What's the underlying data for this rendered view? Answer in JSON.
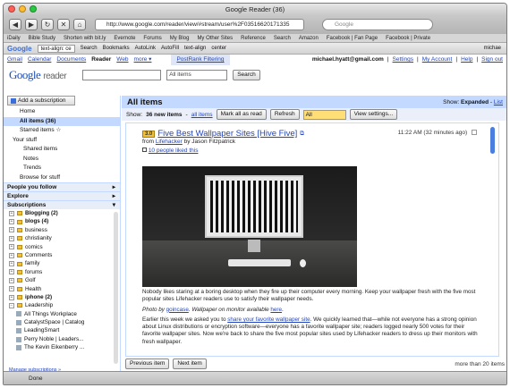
{
  "browser": {
    "title": "Google Reader (36)",
    "url": "http://www.google.com/reader/view/#stream/user%2F03516620171335",
    "search_placeholder": "Google",
    "bookmarks": [
      "iDaily",
      "Bible Study",
      "Shorten with bit.ly",
      "Evernote",
      "Forums",
      "My Blog",
      "My Other Sites",
      "Reference",
      "Search",
      "Amazon",
      "Facebook | Fan Page",
      "Facebook | Private"
    ],
    "gtoolbar": [
      "Google",
      "text-align: ce",
      "Search",
      "Bookmarks",
      "AutoLink",
      "AutoFill",
      "text-align",
      "center",
      "michae"
    ],
    "status": "Done"
  },
  "topnav": {
    "links": [
      "Gmail",
      "Calendar",
      "Documents",
      "Reader",
      "Web",
      "more ▾"
    ],
    "postrank": "PostRank Filtering",
    "email": "michael.hyatt@gmail.com",
    "settings": "Settings",
    "account": "My Account",
    "help": "Help",
    "signout": "Sign out"
  },
  "header": {
    "logo_google": "Google",
    "logo_reader": "reader",
    "scope": "All items",
    "search_btn": "Search"
  },
  "sidebar": {
    "add_sub": "Add a subscription",
    "nav": [
      "Home",
      "All items (36)",
      "Starred items ☆",
      "Your stuff",
      "Shared items",
      "Notes",
      "Trends",
      "Browse for stuff"
    ],
    "people": "People you follow",
    "explore": "Explore",
    "subs_title": "Subscriptions",
    "subs": [
      {
        "label": "Blogging (2)",
        "bold": true
      },
      {
        "label": "blogs (4)",
        "bold": true
      },
      {
        "label": "business",
        "bold": false
      },
      {
        "label": "christianity",
        "bold": false
      },
      {
        "label": "comics",
        "bold": false
      },
      {
        "label": "Comments",
        "bold": false
      },
      {
        "label": "family",
        "bold": false
      },
      {
        "label": "forums",
        "bold": false
      },
      {
        "label": "Golf",
        "bold": false
      },
      {
        "label": "Health",
        "bold": false
      },
      {
        "label": "iphone (2)",
        "bold": true
      },
      {
        "label": "Leadership",
        "bold": false
      }
    ],
    "leadership_children": [
      "All Things Workplace",
      "CatalystSpace | Catalog",
      "LeadingSmart",
      "Perry Noble | Leaders...",
      "The Kevin Eikenberry ..."
    ],
    "manage": "Manage subscriptions »"
  },
  "main": {
    "title": "All items",
    "show_label": "Show:",
    "show_expanded": "Expanded",
    "show_list": "List",
    "ctrl_show": "Show:",
    "ctrl_new": "36 new items",
    "ctrl_all": "all items",
    "mark_read": "Mark all as read",
    "refresh": "Refresh",
    "filter": "All",
    "view_settings": "View settings..."
  },
  "entry": {
    "score": "3.0",
    "title": "Five Best Wallpaper Sites [Hive Five]",
    "from": "from",
    "source": "Lifehacker",
    "author": "by Jason Fitzpatrick",
    "likes": "10 people liked this",
    "date": "11:22 AM (32 minutes ago)",
    "p1": "Nobody likes staring at a boring desktop when they fire up their computer every morning. Keep your wallpaper fresh with the five most popular sites Lifehacker readers use to satisfy their wallpaper needs.",
    "p2_prefix": "Photo by",
    "p2_link1": "goincase",
    "p2_mid": ". Wallpaper on monitor available",
    "p2_link2": "here",
    "p3_prefix": "Earlier this week we asked you to",
    "p3_link": "share your favorite wallpaper site",
    "p3_rest": ". We quickly learned that—while not everyone has a strong opinion about Linux distributions or encryption software—everyone has a favorite wallpaper site; readers logged nearly 500 votes for their favorite wallpaper sites. Now we're back to share the five most popular sites used by Lifehacker readers to dress up their monitors with fresh wallpaper."
  },
  "footer": {
    "prev": "Previous item",
    "next": "Next item",
    "more": "more than 20 items"
  }
}
